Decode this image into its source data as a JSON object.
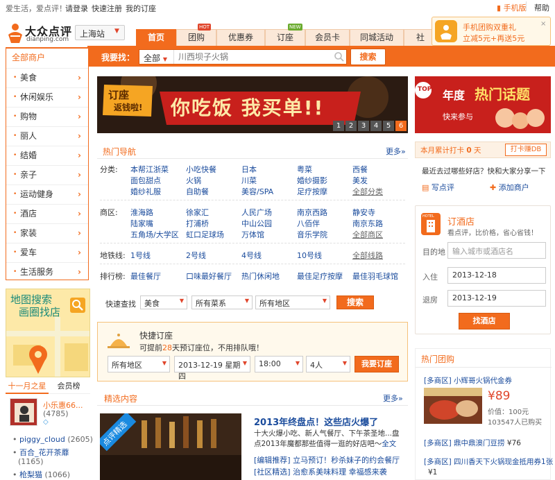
{
  "topbar": {
    "slogan": "爱生活，爱点评！",
    "login": "请登录",
    "register": "快速注册",
    "my_booking": "我的订座",
    "mobile": "手机版",
    "help": "帮助"
  },
  "logo": {
    "name": "大众点评",
    "domain": "dianping.com"
  },
  "city": "上海站",
  "nav": {
    "tabs": [
      {
        "label": "首页",
        "active": true
      },
      {
        "label": "团购",
        "badge": "HOT"
      },
      {
        "label": "优惠券"
      },
      {
        "label": "订座",
        "badge": "NEW"
      },
      {
        "label": "会员卡"
      },
      {
        "label": "同城活动"
      },
      {
        "label": "社"
      }
    ]
  },
  "promo": {
    "title": "手机团购双重礼",
    "detail": "立减5元+再送5元"
  },
  "search": {
    "label": "我要找：",
    "category": "全部",
    "placeholder": "川西坝子火锅",
    "button": "搜索"
  },
  "sidebar": {
    "title": "全部商户",
    "items": [
      "美食",
      "休闲娱乐",
      "购物",
      "丽人",
      "结婚",
      "亲子",
      "运动健身",
      "酒店",
      "家装",
      "爱车",
      "生活服务"
    ]
  },
  "map": {
    "line1": "地图搜索",
    "line2": "画圈找店"
  },
  "stars": {
    "tab1": "十一月之星",
    "tab2": "会员榜",
    "featured_name": "小乐惠66...",
    "featured_count": "(4785)",
    "list": [
      {
        "name": "piggy_cloud",
        "count": "(2605)"
      },
      {
        "name": "百合_花开茶蘼",
        "count": "(1165)"
      },
      {
        "name": "枪梨猫",
        "count": "(1066)"
      }
    ]
  },
  "banner": {
    "tag1": "订座",
    "tag2": "返钱啦!",
    "headline": "你吃饭 我买单!!",
    "pages": [
      "1",
      "2",
      "3",
      "4",
      "5",
      "6"
    ]
  },
  "hotnav": {
    "title": "热门导航",
    "more": "更多»",
    "category_label": "分类:",
    "categories": [
      [
        "本帮江浙菜",
        "小吃快餐",
        "日本",
        "粤菜",
        "西餐"
      ],
      [
        "面包甜点",
        "火锅",
        "川菜",
        "婚纱摄影",
        "美发"
      ],
      [
        "婚纱礼服",
        "自助餐",
        "美容/SPA",
        "足疗按摩",
        "全部分类"
      ]
    ],
    "district_label": "商区:",
    "districts": [
      [
        "淮海路",
        "徐家汇",
        "人民广场",
        "南京西路",
        "静安寺"
      ],
      [
        "陆家嘴",
        "打浦桥",
        "中山公园",
        "八佰伴",
        "南京东路"
      ],
      [
        "五角场/大学区",
        "虹口足球场",
        "万体馆",
        "音乐学院",
        "全部商区"
      ]
    ],
    "metro_label": "地铁线:",
    "metro": [
      "1号线",
      "2号线",
      "4号线",
      "10号线",
      "全部线路"
    ],
    "rank_label": "排行榜:",
    "ranks": [
      "最佳餐厅",
      "口味最好餐厅",
      "热门休闲地",
      "最佳足疗按摩",
      "最佳羽毛球馆"
    ]
  },
  "quicksearch": {
    "label": "快速查找",
    "sel1": "美食",
    "sel2": "所有菜系",
    "sel3": "所有地区",
    "button": "搜索"
  },
  "booking": {
    "title": "快捷订座",
    "desc_pre": "可提前",
    "desc_days": "28",
    "desc_post": "天预订座位，不用排队哦！",
    "area": "所有地区",
    "date": "2013-12-19 星期四",
    "time": "18:00",
    "people": "4人",
    "button": "我要订座"
  },
  "selected": {
    "title": "精选内容",
    "more": "更多»",
    "img_tag": "点评精选",
    "headline": "2013年终盘点！这些店火爆了",
    "summary": "十大火爆小吃、新人气餐厅、下午茶圣地...盘点2013年魔都那些值得一逛的好店吧～",
    "summary_link": "全文",
    "items": [
      {
        "tag": "[编辑推荐]",
        "text": "立马预订！秒杀妹子的约会餐厅"
      },
      {
        "tag": "[社区精选]",
        "text": "治愈系美味料理 幸福感来袭"
      }
    ]
  },
  "right_ad": {
    "top": "TOP",
    "line1": "年度",
    "line2": "热门话题",
    "line3": "快来参与"
  },
  "checkin": {
    "label": "本月累计打卡",
    "count": "0",
    "unit": "天",
    "button": "打卡赚DB",
    "question": "最近去过哪些好店？快和大家分享一下",
    "write": "写点评",
    "add": "添加商户"
  },
  "hotel": {
    "title": "订酒店",
    "subtitle": "看点评，比价格，省心省钱！",
    "dest_label": "目的地",
    "dest_placeholder": "输入城市或酒店名",
    "in_label": "入住",
    "in_date": "2013-12-18",
    "out_label": "退房",
    "out_date": "2013-12-19",
    "button": "找酒店",
    "icon_text": "HOTEL"
  },
  "tuan": {
    "title": "热门团购",
    "deal1": {
      "tag": "[多商区]",
      "name": "小辉哥火锅代金券",
      "price": "¥89",
      "value": "价值：100元",
      "sold": "103547人已购买"
    },
    "deal2": {
      "tag": "[多商区]",
      "name": "鼎中鼎澳门豆捞",
      "price": "¥76"
    },
    "deal3": {
      "tag": "[多商区]",
      "name": "四川香天下火锅现金抵用券1张",
      "price": "¥1"
    }
  },
  "colors": {
    "accent": "#f26b1d",
    "link": "#1a4b9c",
    "price": "#e0452b"
  }
}
